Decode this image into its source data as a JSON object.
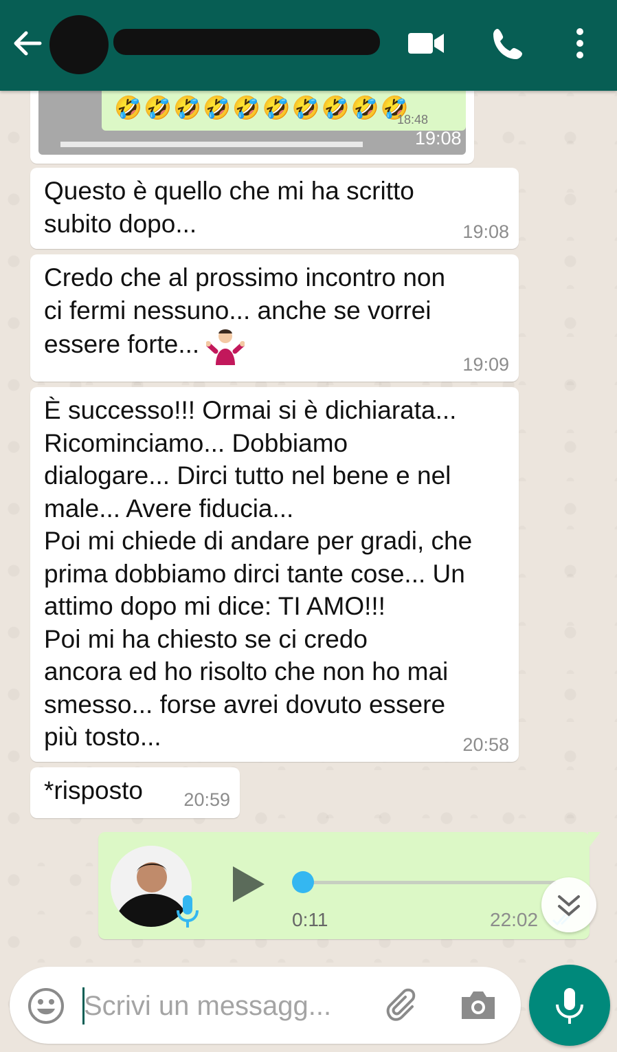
{
  "colors": {
    "header": "#075e54",
    "incoming_bubble": "#ffffff",
    "outgoing_bubble": "#dcf8c6",
    "chat_background": "#ece5dd",
    "accent": "#00897b",
    "voice_progress": "#34b7f1"
  },
  "header": {
    "contact_name": "",
    "icons": [
      "back-arrow-icon",
      "video-call-icon",
      "phone-call-icon",
      "more-options-icon"
    ]
  },
  "quoted_media": {
    "emojis": "🤣🤣🤣🤣🤣🤣🤣🤣🤣🤣",
    "inner_time": "18:48",
    "time": "19:08"
  },
  "messages": [
    {
      "text": "Questo è quello che mi ha scritto\nsubito dopo...",
      "time": "19:08"
    },
    {
      "text": "Credo che al prossimo incontro non\nci fermi nessuno... anche se vorrei\nessere forte...",
      "emoji": "person-shrugging",
      "time": "19:09"
    },
    {
      "text": "È successo!!! Ormai si è dichiarata...\nRicominciamo... Dobbiamo\ndialogare... Dirci tutto nel bene e nel\nmale... Avere fiducia...\nPoi mi chiede di andare per gradi, che\nprima dobbiamo dirci tante cose... Un\nattimo dopo mi dice: TI AMO!!!\nPoi mi ha chiesto se ci credo\nancora ed ho risolto che non ho mai\nsmesso... forse avrei dovuto essere\npiù tosto...",
      "time": "20:58"
    },
    {
      "text": "*risposto",
      "time": "20:59"
    }
  ],
  "voice_message": {
    "duration": "0:11",
    "time": "22:02",
    "progress": 0
  },
  "composer": {
    "placeholder": "Scrivi un messagg..."
  }
}
